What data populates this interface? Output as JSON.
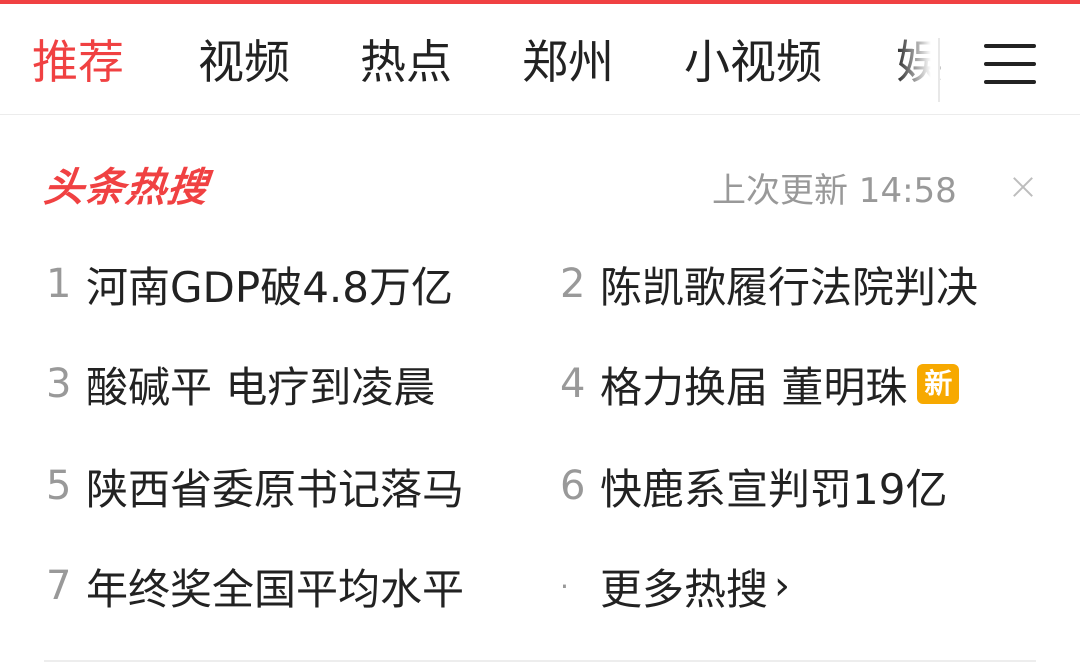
{
  "tabs": [
    {
      "label": "推荐",
      "active": true
    },
    {
      "label": "视频",
      "active": false
    },
    {
      "label": "热点",
      "active": false
    },
    {
      "label": "郑州",
      "active": false
    },
    {
      "label": "小视频",
      "active": false
    },
    {
      "label": "娱",
      "active": false
    }
  ],
  "hot": {
    "logo_text": "头条热搜",
    "update_text": "上次更新 14:58",
    "items": [
      {
        "rank": "1",
        "title": "河南GDP破4.8万亿"
      },
      {
        "rank": "2",
        "title": "陈凯歌履行法院判决"
      },
      {
        "rank": "3",
        "title": "酸碱平 电疗到凌晨"
      },
      {
        "rank": "4",
        "title": "格力换届 董明珠",
        "badge": "新"
      },
      {
        "rank": "5",
        "title": "陕西省委原书记落马"
      },
      {
        "rank": "6",
        "title": "快鹿系宣判罚19亿"
      },
      {
        "rank": "7",
        "title": "年终奖全国平均水平"
      }
    ],
    "more": {
      "bullet": "·",
      "label": "更多热搜",
      "chevron": "›"
    }
  },
  "colors": {
    "accent": "#f04142",
    "badge": "#f7a900",
    "muted": "#999999",
    "text": "#222222"
  },
  "icons": {
    "menu": "hamburger-menu-icon",
    "close": "close-icon",
    "more": "chevron-right-icon"
  }
}
